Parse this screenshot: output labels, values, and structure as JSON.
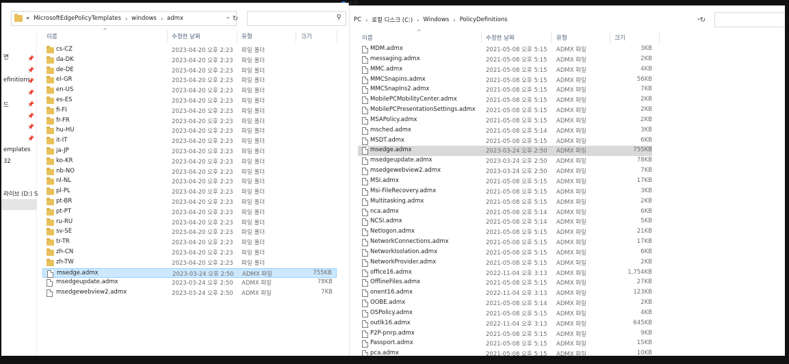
{
  "left": {
    "breadcrumb": [
      "«",
      "MicrosoftEdgePolicyTemplates",
      "windows",
      "admx"
    ],
    "nav_items": [
      "면",
      "efinitions",
      "드",
      "emplates",
      "32",
      "라이브 (D:) S"
    ],
    "columns": {
      "name": "이름",
      "date": "수정한 날짜",
      "type": "유형",
      "size": "크기"
    },
    "rows": [
      {
        "name": "cs-CZ",
        "date": "2023-04-20 오후 2:23",
        "type": "파일 폴더",
        "size": "",
        "kind": "folder"
      },
      {
        "name": "da-DK",
        "date": "2023-04-20 오후 2:23",
        "type": "파일 폴더",
        "size": "",
        "kind": "folder"
      },
      {
        "name": "de-DE",
        "date": "2023-04-20 오후 2:23",
        "type": "파일 폴더",
        "size": "",
        "kind": "folder"
      },
      {
        "name": "el-GR",
        "date": "2023-04-20 오후 2:23",
        "type": "파일 폴더",
        "size": "",
        "kind": "folder"
      },
      {
        "name": "en-US",
        "date": "2023-04-20 오후 2:23",
        "type": "파일 폴더",
        "size": "",
        "kind": "folder"
      },
      {
        "name": "es-ES",
        "date": "2023-04-20 오후 2:23",
        "type": "파일 폴더",
        "size": "",
        "kind": "folder"
      },
      {
        "name": "fi-FI",
        "date": "2023-04-20 오후 2:23",
        "type": "파일 폴더",
        "size": "",
        "kind": "folder"
      },
      {
        "name": "fr-FR",
        "date": "2023-04-20 오후 2:23",
        "type": "파일 폴더",
        "size": "",
        "kind": "folder"
      },
      {
        "name": "hu-HU",
        "date": "2023-04-20 오후 2:23",
        "type": "파일 폴더",
        "size": "",
        "kind": "folder"
      },
      {
        "name": "it-IT",
        "date": "2023-04-20 오후 2:23",
        "type": "파일 폴더",
        "size": "",
        "kind": "folder"
      },
      {
        "name": "ja-JP",
        "date": "2023-04-20 오후 2:23",
        "type": "파일 폴더",
        "size": "",
        "kind": "folder"
      },
      {
        "name": "ko-KR",
        "date": "2023-04-20 오후 2:23",
        "type": "파일 폴더",
        "size": "",
        "kind": "folder"
      },
      {
        "name": "nb-NO",
        "date": "2023-04-20 오후 2:23",
        "type": "파일 폴더",
        "size": "",
        "kind": "folder"
      },
      {
        "name": "nl-NL",
        "date": "2023-04-20 오후 2:23",
        "type": "파일 폴더",
        "size": "",
        "kind": "folder"
      },
      {
        "name": "pl-PL",
        "date": "2023-04-20 오후 2:23",
        "type": "파일 폴더",
        "size": "",
        "kind": "folder"
      },
      {
        "name": "pt-BR",
        "date": "2023-04-20 오후 2:23",
        "type": "파일 폴더",
        "size": "",
        "kind": "folder"
      },
      {
        "name": "pt-PT",
        "date": "2023-04-20 오후 2:23",
        "type": "파일 폴더",
        "size": "",
        "kind": "folder"
      },
      {
        "name": "ru-RU",
        "date": "2023-04-20 오후 2:23",
        "type": "파일 폴더",
        "size": "",
        "kind": "folder"
      },
      {
        "name": "sv-SE",
        "date": "2023-04-20 오후 2:23",
        "type": "파일 폴더",
        "size": "",
        "kind": "folder"
      },
      {
        "name": "tr-TR",
        "date": "2023-04-20 오후 2:23",
        "type": "파일 폴더",
        "size": "",
        "kind": "folder"
      },
      {
        "name": "zh-CN",
        "date": "2023-04-20 오후 2:23",
        "type": "파일 폴더",
        "size": "",
        "kind": "folder"
      },
      {
        "name": "zh-TW",
        "date": "2023-04-20 오후 2:23",
        "type": "파일 폴더",
        "size": "",
        "kind": "folder"
      },
      {
        "name": "msedge.admx",
        "date": "2023-03-24 오후 2:50",
        "type": "ADMX 파일",
        "size": "755KB",
        "kind": "file",
        "selected": true
      },
      {
        "name": "msedgeupdate.admx",
        "date": "2023-03-24 오후 2:50",
        "type": "ADMX 파일",
        "size": "78KB",
        "kind": "file"
      },
      {
        "name": "msedgewebview2.admx",
        "date": "2023-03-24 오후 2:50",
        "type": "ADMX 파일",
        "size": "7KB",
        "kind": "file"
      }
    ]
  },
  "right": {
    "breadcrumb": [
      "PC",
      "로컬 디스크 (C:)",
      "Windows",
      "PolicyDefinitions"
    ],
    "columns": {
      "name": "이름",
      "date": "수정한 날짜",
      "type": "유형",
      "size": "크기"
    },
    "rows": [
      {
        "name": "MDM.admx",
        "date": "2021-05-08 오후 5:15",
        "type": "ADMX 파일",
        "size": "3KB"
      },
      {
        "name": "messaging.admx",
        "date": "2021-05-08 오후 5:15",
        "type": "ADMX 파일",
        "size": "2KB"
      },
      {
        "name": "MMC.admx",
        "date": "2021-05-08 오후 5:15",
        "type": "ADMX 파일",
        "size": "4KB"
      },
      {
        "name": "MMCSnapins.admx",
        "date": "2021-05-08 오후 5:15",
        "type": "ADMX 파일",
        "size": "56KB"
      },
      {
        "name": "MMCSnapIns2.admx",
        "date": "2021-05-08 오후 5:15",
        "type": "ADMX 파일",
        "size": "7KB"
      },
      {
        "name": "MobilePCMobilityCenter.admx",
        "date": "2021-05-08 오후 5:15",
        "type": "ADMX 파일",
        "size": "2KB"
      },
      {
        "name": "MobilePCPresentationSettings.admx",
        "date": "2021-05-08 오후 5:15",
        "type": "ADMX 파일",
        "size": "2KB"
      },
      {
        "name": "MSAPolicy.admx",
        "date": "2021-05-08 오후 5:15",
        "type": "ADMX 파일",
        "size": "2KB"
      },
      {
        "name": "msched.admx",
        "date": "2021-05-08 오후 5:14",
        "type": "ADMX 파일",
        "size": "3KB"
      },
      {
        "name": "MSDT.admx",
        "date": "2021-05-08 오후 5:15",
        "type": "ADMX 파일",
        "size": "6KB"
      },
      {
        "name": "msedge.admx",
        "date": "2023-03-24 오후 2:50",
        "type": "ADMX 파일",
        "size": "755KB",
        "selected": true
      },
      {
        "name": "msedgeupdate.admx",
        "date": "2023-03-24 오후 2:50",
        "type": "ADMX 파일",
        "size": "78KB"
      },
      {
        "name": "msedgewebview2.admx",
        "date": "2023-03-24 오후 2:50",
        "type": "ADMX 파일",
        "size": "7KB"
      },
      {
        "name": "MSI.admx",
        "date": "2021-05-08 오후 5:15",
        "type": "ADMX 파일",
        "size": "17KB"
      },
      {
        "name": "Msi-FileRecovery.admx",
        "date": "2021-05-08 오후 5:15",
        "type": "ADMX 파일",
        "size": "3KB"
      },
      {
        "name": "Multitasking.admx",
        "date": "2021-05-08 오후 5:15",
        "type": "ADMX 파일",
        "size": "2KB"
      },
      {
        "name": "nca.admx",
        "date": "2021-05-08 오후 5:14",
        "type": "ADMX 파일",
        "size": "6KB"
      },
      {
        "name": "NCSI.admx",
        "date": "2021-05-08 오후 5:14",
        "type": "ADMX 파일",
        "size": "5KB"
      },
      {
        "name": "Netlogon.admx",
        "date": "2021-05-08 오후 5:15",
        "type": "ADMX 파일",
        "size": "21KB"
      },
      {
        "name": "NetworkConnections.admx",
        "date": "2021-05-08 오후 5:15",
        "type": "ADMX 파일",
        "size": "17KB"
      },
      {
        "name": "NetworkIsolation.admx",
        "date": "2021-05-08 오후 5:15",
        "type": "ADMX 파일",
        "size": "6KB"
      },
      {
        "name": "NetworkProvider.admx",
        "date": "2021-05-08 오후 5:15",
        "type": "ADMX 파일",
        "size": "2KB"
      },
      {
        "name": "office16.admx",
        "date": "2022-11-04 오후 3:13",
        "type": "ADMX 파일",
        "size": "1,754KB"
      },
      {
        "name": "OfflineFiles.admx",
        "date": "2021-05-08 오후 5:15",
        "type": "ADMX 파일",
        "size": "27KB"
      },
      {
        "name": "onent16.admx",
        "date": "2022-11-04 오후 3:13",
        "type": "ADMX 파일",
        "size": "123KB"
      },
      {
        "name": "OOBE.admx",
        "date": "2021-05-08 오후 5:14",
        "type": "ADMX 파일",
        "size": "2KB"
      },
      {
        "name": "OSPolicy.admx",
        "date": "2021-05-08 오후 5:15",
        "type": "ADMX 파일",
        "size": "4KB"
      },
      {
        "name": "outlk16.admx",
        "date": "2022-11-04 오후 3:13",
        "type": "ADMX 파일",
        "size": "645KB"
      },
      {
        "name": "P2P-pnrp.admx",
        "date": "2021-05-08 오후 5:15",
        "type": "ADMX 파일",
        "size": "9KB"
      },
      {
        "name": "Passport.admx",
        "date": "2021-05-08 오후 5:15",
        "type": "ADMX 파일",
        "size": "15KB"
      },
      {
        "name": "pca.admx",
        "date": "2021-05-08 오후 5:15",
        "type": "ADMX 파일",
        "size": "10KB"
      }
    ]
  },
  "top_sliver_text": "보기",
  "colors": {
    "selected_blue": "#cce8ff",
    "selected_grey": "#d9d9d9",
    "folder": "#e8c15a"
  }
}
